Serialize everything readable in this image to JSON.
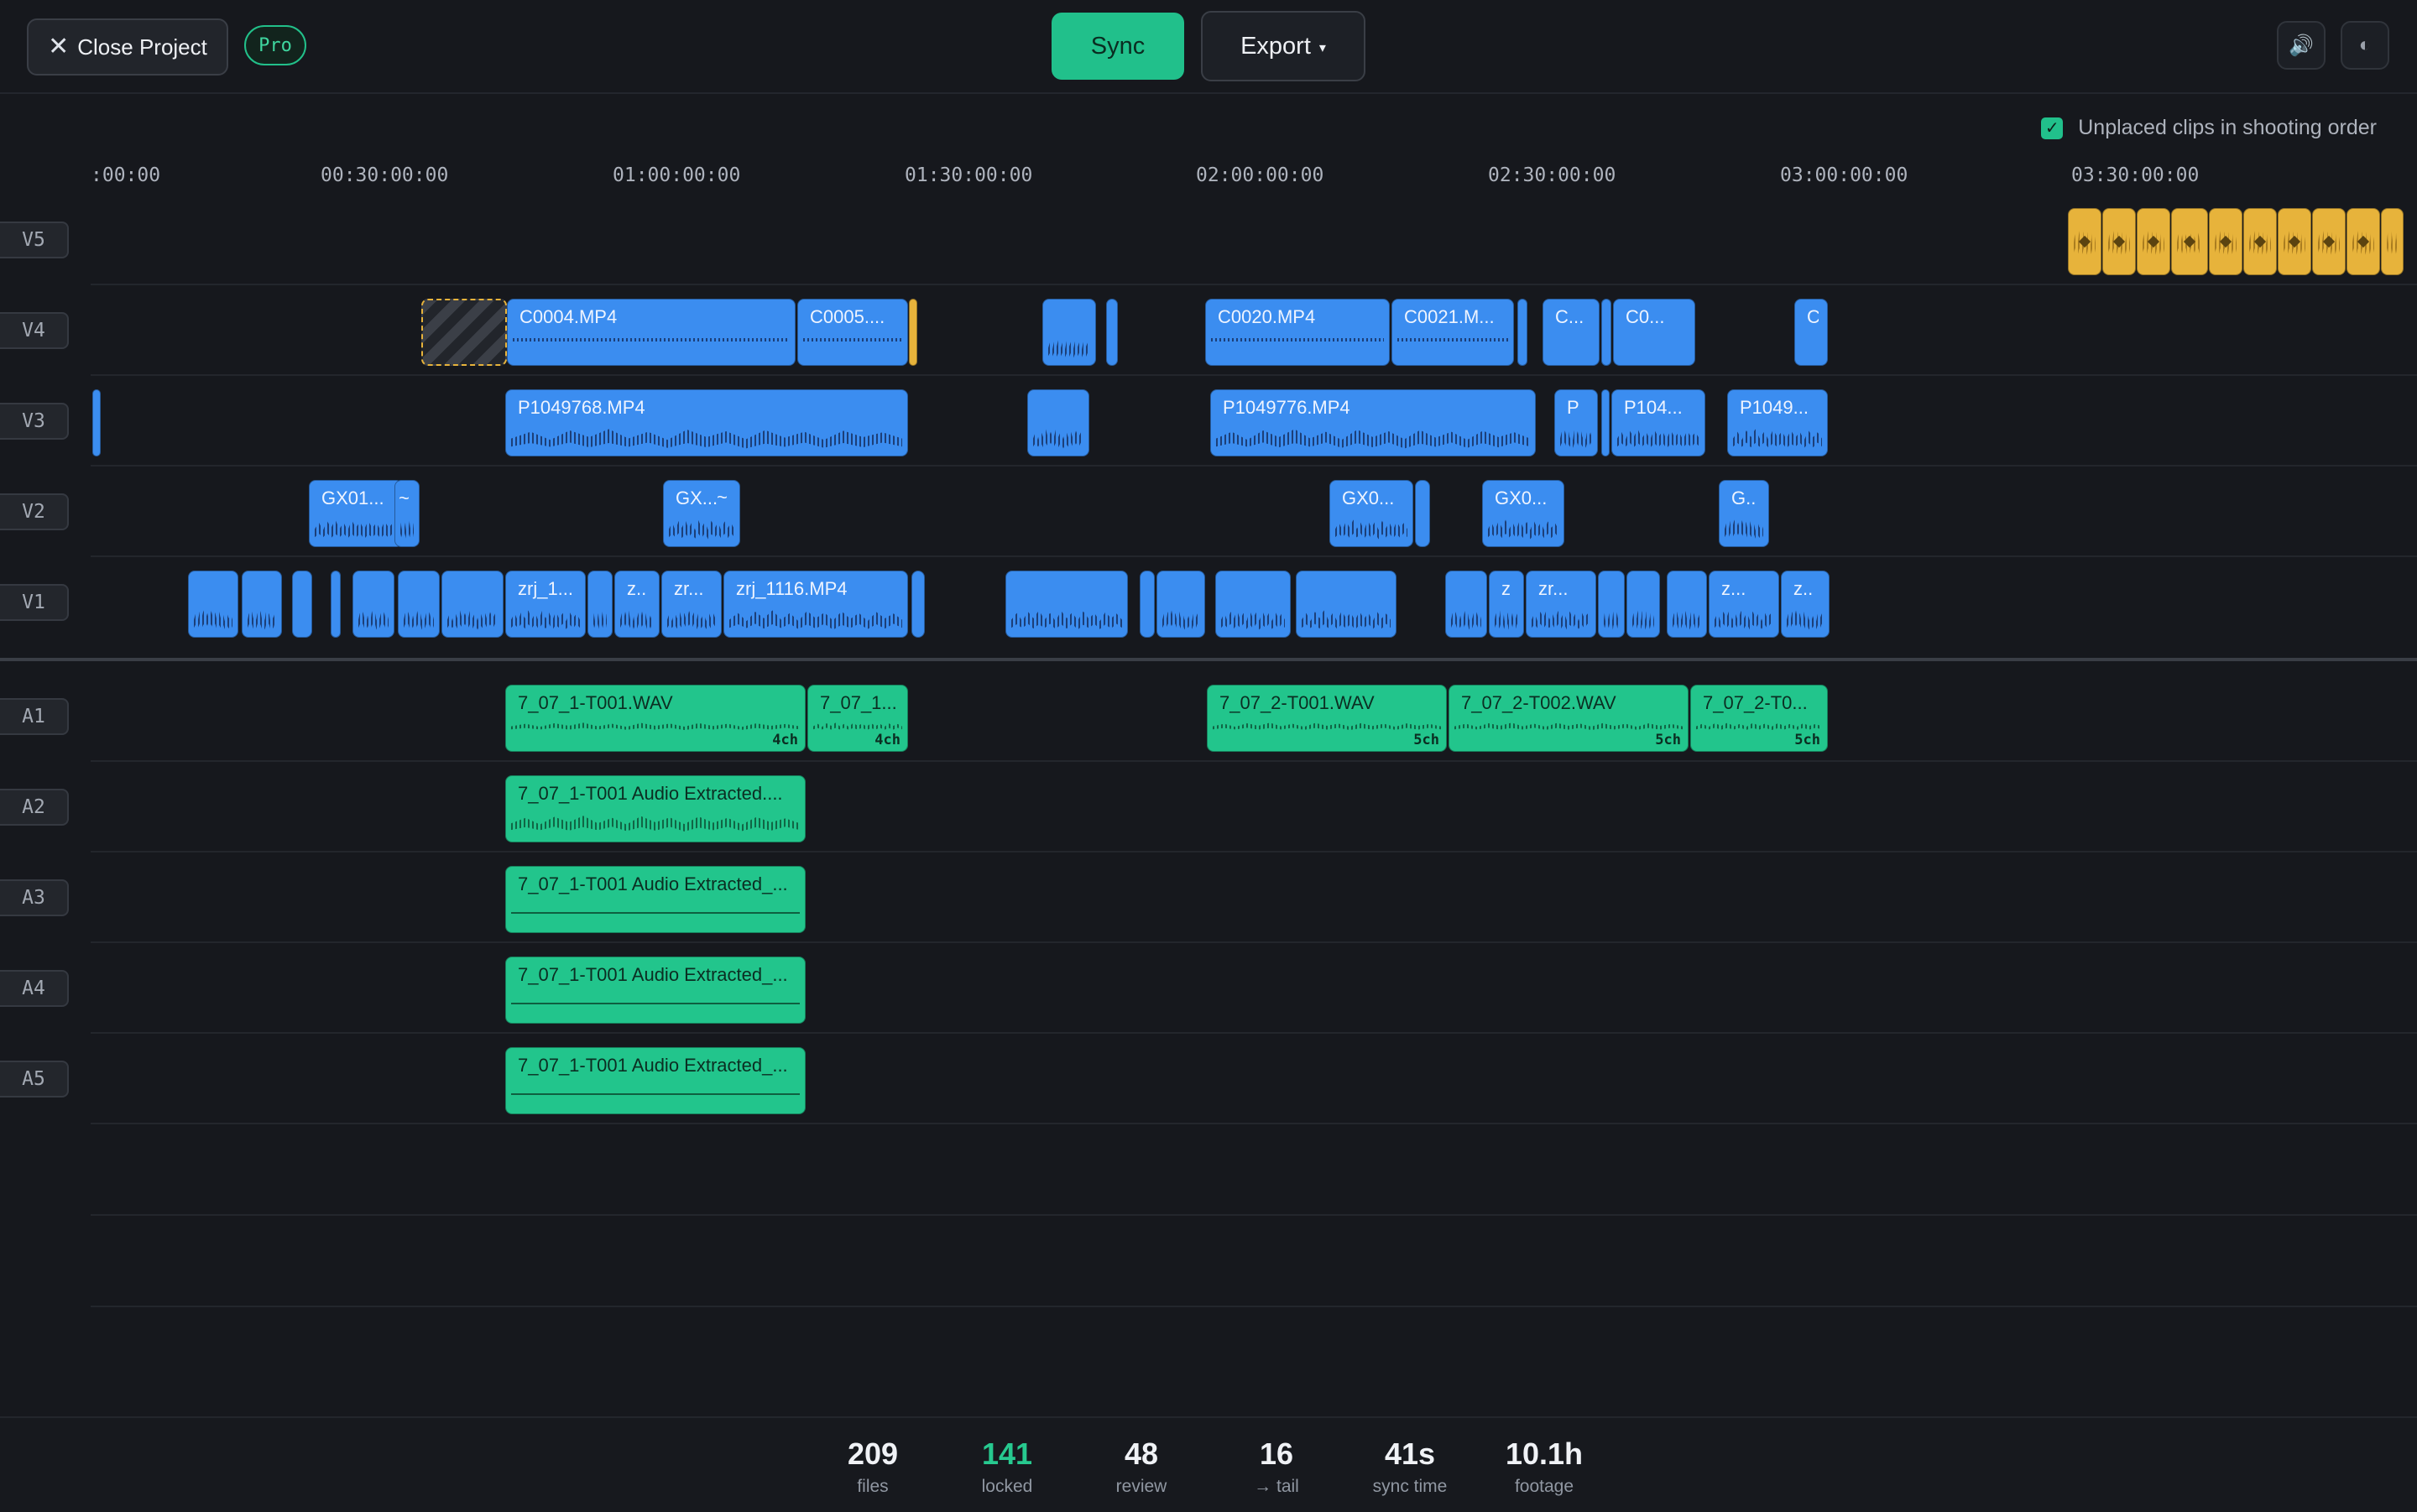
{
  "toolbar": {
    "close_label": "Close Project",
    "pro_badge": "Pro",
    "sync_label": "Sync",
    "export_label": "Export",
    "export_caret": "▾",
    "volume_icon": "🔊",
    "theme_icon": "◐"
  },
  "options": {
    "shooting_order_label": "Unplaced clips in shooting order",
    "shooting_order_checked": true
  },
  "ruler": {
    "ticks": [
      ":00:00",
      "00:30:00:00",
      "01:00:00:00",
      "01:30:00:00",
      "02:00:00:00",
      "02:30:00:00",
      "03:00:00:00",
      "03:30:00:00"
    ]
  },
  "tracks": {
    "video": [
      "V5",
      "V4",
      "V3",
      "V2",
      "V1"
    ],
    "audio": [
      "A1",
      "A2",
      "A3",
      "A4",
      "A5"
    ]
  },
  "clips": {
    "v4": [
      "C0004.MP4",
      "C0005....",
      "C0020.MP4",
      "C0021.M...",
      "C...",
      "C0...",
      "C"
    ],
    "v3": [
      "P1049768.MP4",
      "P1049776.MP4",
      "P",
      "P104...",
      "P1049..."
    ],
    "v2": [
      "GX01...",
      "~",
      "GX...",
      "~",
      "GX0...",
      "GX0...",
      "G.."
    ],
    "v1": [
      "zrj_1...",
      "z..",
      "zr...",
      "zrj_1116.MP4",
      "z",
      "zr...",
      "z...",
      "z.."
    ],
    "a1": [
      {
        "name": "7_07_1-T001.WAV",
        "ch": "4ch"
      },
      {
        "name": "7_07_1...",
        "ch": "4ch"
      },
      {
        "name": "7_07_2-T001.WAV",
        "ch": "5ch"
      },
      {
        "name": "7_07_2-T002.WAV",
        "ch": "5ch"
      },
      {
        "name": "7_07_2-T0...",
        "ch": "5ch"
      }
    ],
    "a2": [
      "7_07_1-T001 Audio Extracted...."
    ],
    "a3": [
      "7_07_1-T001 Audio Extracted_..."
    ],
    "a4": [
      "7_07_1-T001 Audio Extracted_..."
    ],
    "a5": [
      "7_07_1-T001 Audio Extracted_..."
    ]
  },
  "stats": [
    {
      "value": "209",
      "label": "files",
      "highlight": false
    },
    {
      "value": "141",
      "label": "locked",
      "highlight": true
    },
    {
      "value": "48",
      "label": "review",
      "highlight": false
    },
    {
      "value": "16",
      "label": "→ tail",
      "highlight": false
    },
    {
      "value": "41s",
      "label": "sync time",
      "highlight": false
    },
    {
      "value": "10.1h",
      "label": "footage",
      "highlight": false
    }
  ],
  "colors": {
    "video_clip": "#3b8df0",
    "audio_clip": "#22c58c",
    "unplaced_clip": "#e7b33b",
    "accent": "#21c08b",
    "background": "#16181d"
  }
}
